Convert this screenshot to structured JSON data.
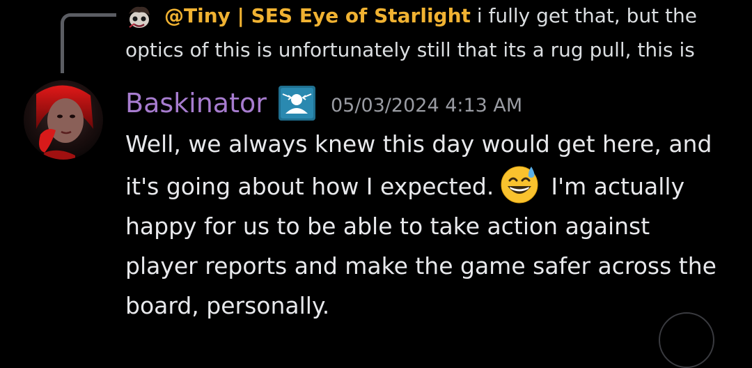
{
  "reply": {
    "author": "@Tiny | SES Eye of Starlight",
    "text_line_1": "i fully get that, but the",
    "text_line_2": "optics of this is unfortunately still that its a rug pull, this is",
    "author_color": "#f0b232"
  },
  "message": {
    "author": "Baskinator",
    "author_color": "#a77ccf",
    "role_icon": "person-with-arrows-icon",
    "timestamp": "05/03/2024 4:13 AM",
    "lines": [
      "Well, we always knew this day would get here, and",
      "it's going about how I expected.",
      "I'm actually",
      "happy for us to be able to take action against",
      "player reports and make the game safer across the",
      "board, personally."
    ],
    "emoji": "grinning-face-with-sweat-emoji"
  }
}
